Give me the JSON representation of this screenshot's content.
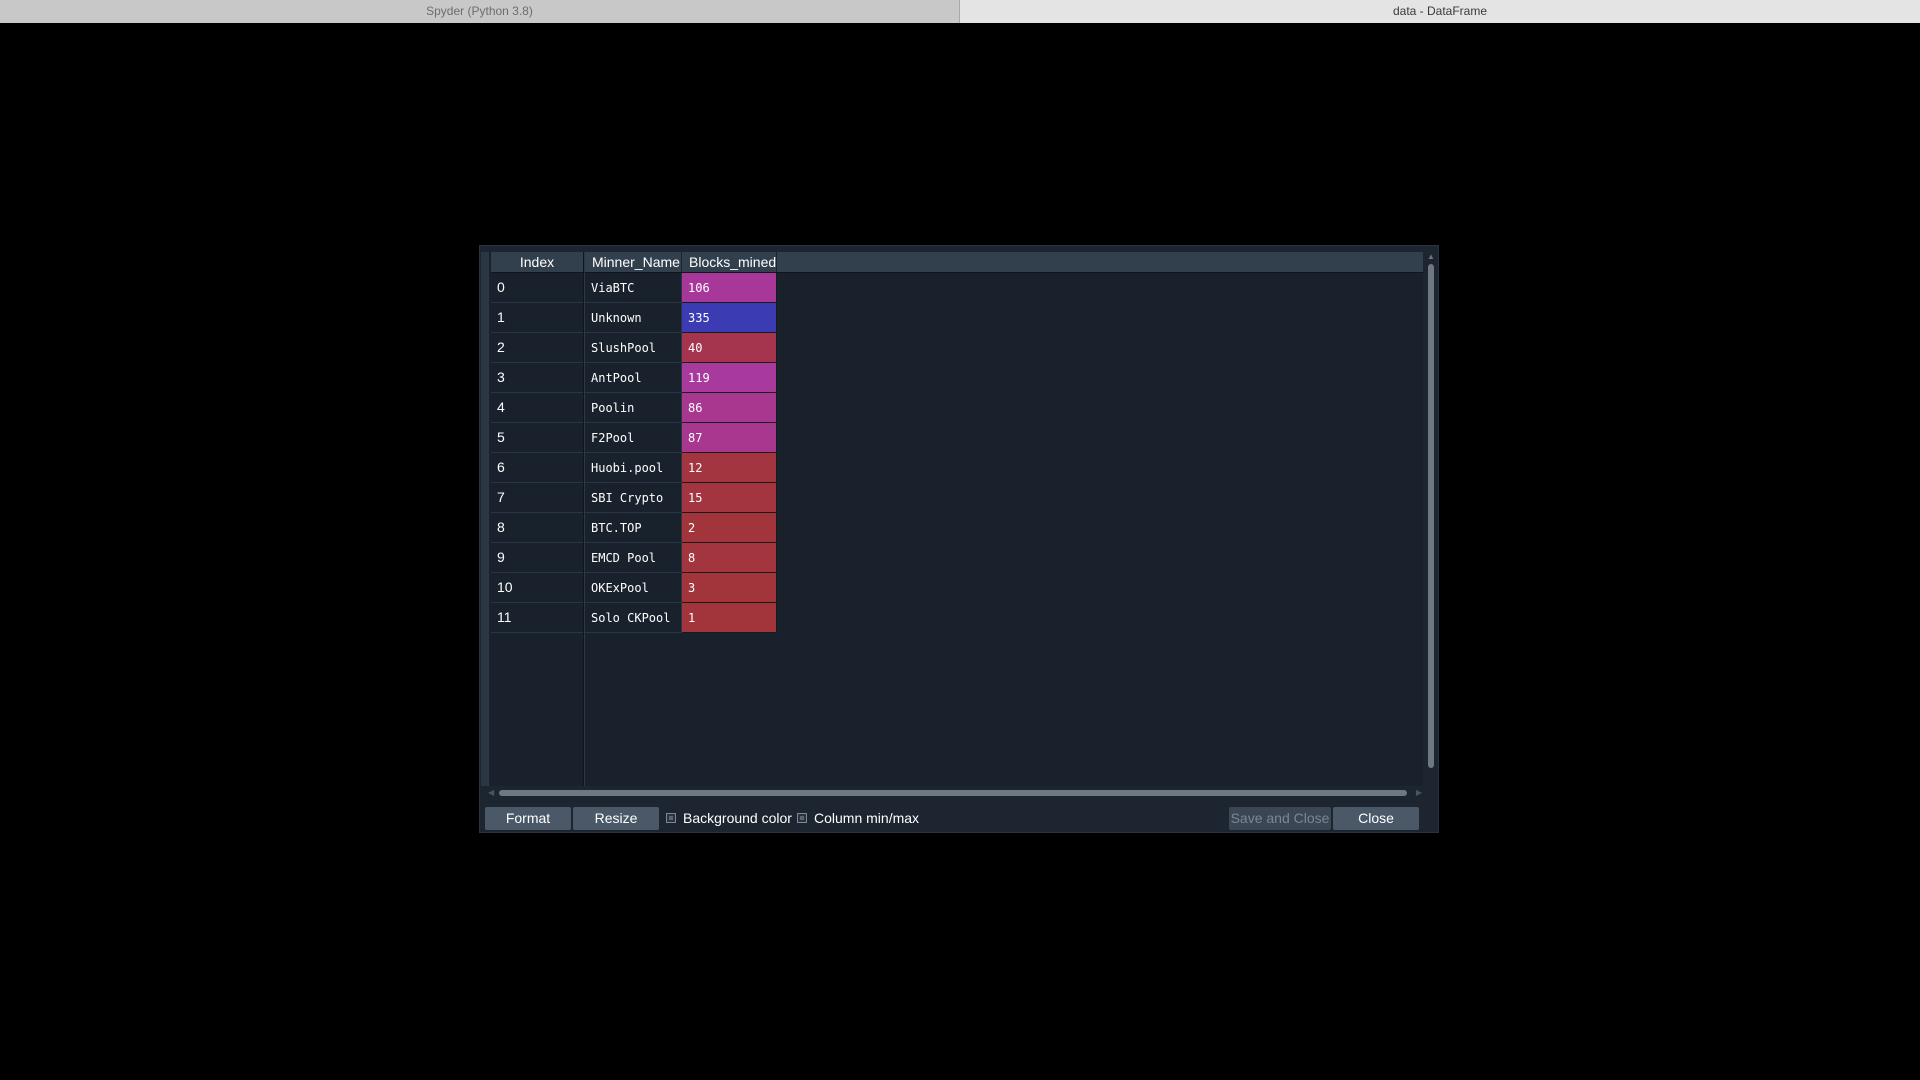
{
  "tabs": [
    {
      "label": "Spyder (Python 3.8)",
      "active": false
    },
    {
      "label": "data - DataFrame",
      "active": true
    }
  ],
  "table": {
    "index_header": "Index",
    "columns": [
      "Minner_Name",
      "Blocks_mined"
    ],
    "rows": [
      {
        "index": "0",
        "name": "ViaBTC",
        "blocks": "106",
        "color": "#a8379a"
      },
      {
        "index": "1",
        "name": "Unknown",
        "blocks": "335",
        "color": "#3b3bb3"
      },
      {
        "index": "2",
        "name": "SlushPool",
        "blocks": "40",
        "color": "#a5344f"
      },
      {
        "index": "3",
        "name": "AntPool",
        "blocks": "119",
        "color": "#a83a9e"
      },
      {
        "index": "4",
        "name": "Poolin",
        "blocks": "86",
        "color": "#a83790"
      },
      {
        "index": "5",
        "name": "F2Pool",
        "blocks": "87",
        "color": "#a83790"
      },
      {
        "index": "6",
        "name": "Huobi.pool",
        "blocks": "12",
        "color": "#a33540"
      },
      {
        "index": "7",
        "name": "SBI Crypto",
        "blocks": "15",
        "color": "#a33541"
      },
      {
        "index": "8",
        "name": "BTC.TOP",
        "blocks": "2",
        "color": "#a2343c"
      },
      {
        "index": "9",
        "name": "EMCD Pool",
        "blocks": "8",
        "color": "#a2353e"
      },
      {
        "index": "10",
        "name": "OKExPool",
        "blocks": "3",
        "color": "#a2343c"
      },
      {
        "index": "11",
        "name": "Solo CKPool",
        "blocks": "1",
        "color": "#a2343b"
      }
    ]
  },
  "footer": {
    "format_label": "Format",
    "resize_label": "Resize",
    "background_color_label": "Background color",
    "background_color_checked": false,
    "column_minmax_label": "Column min/max",
    "column_minmax_checked": false,
    "save_close_label": "Save and Close",
    "close_label": "Close"
  }
}
